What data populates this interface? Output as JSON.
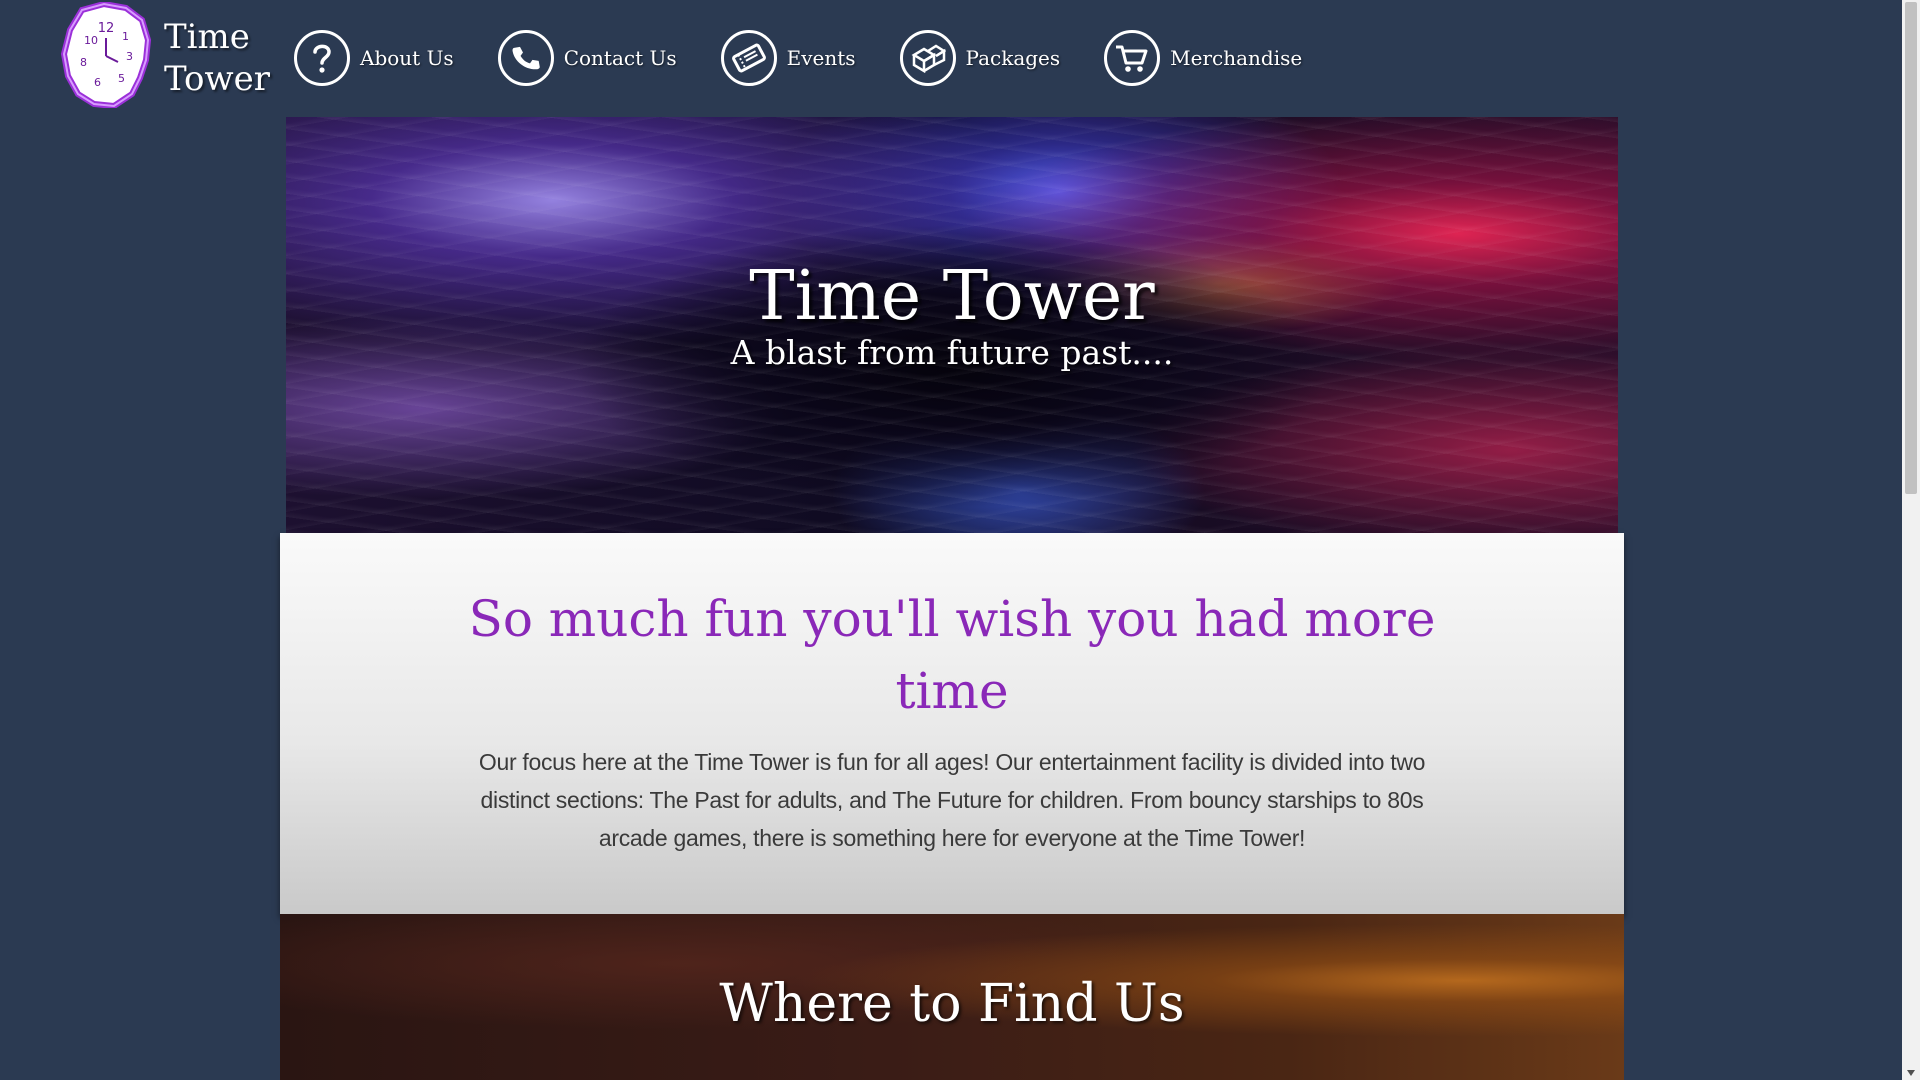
{
  "brand": {
    "line1": "Time",
    "line2": "Tower",
    "logo_icon": "melting-clock-icon",
    "accent_color": "#9b30d9"
  },
  "nav": {
    "items": [
      {
        "label": "About Us",
        "icon": "question-icon"
      },
      {
        "label": "Contact Us",
        "icon": "phone-icon"
      },
      {
        "label": "Events",
        "icon": "ticket-icon"
      },
      {
        "label": "Packages",
        "icon": "packages-icon"
      },
      {
        "label": "Merchandise",
        "icon": "cart-icon"
      }
    ]
  },
  "hero": {
    "title": "Time Tower",
    "subtitle": "A blast from future past...."
  },
  "intro": {
    "heading": "So much fun you'll wish you had more time",
    "body": "Our focus here at the Time Tower is fun for all ages! Our entertainment facility is divided into two distinct sections: The Past for adults, and The Future for children. From bouncy starships to 80s arcade games, there is something here for everyone at the Time Tower!",
    "heading_color": "#8a28b8"
  },
  "findus": {
    "heading": "Where to Find Us"
  },
  "colors": {
    "background": "#2b3a52",
    "nav_text": "#ffffff"
  }
}
